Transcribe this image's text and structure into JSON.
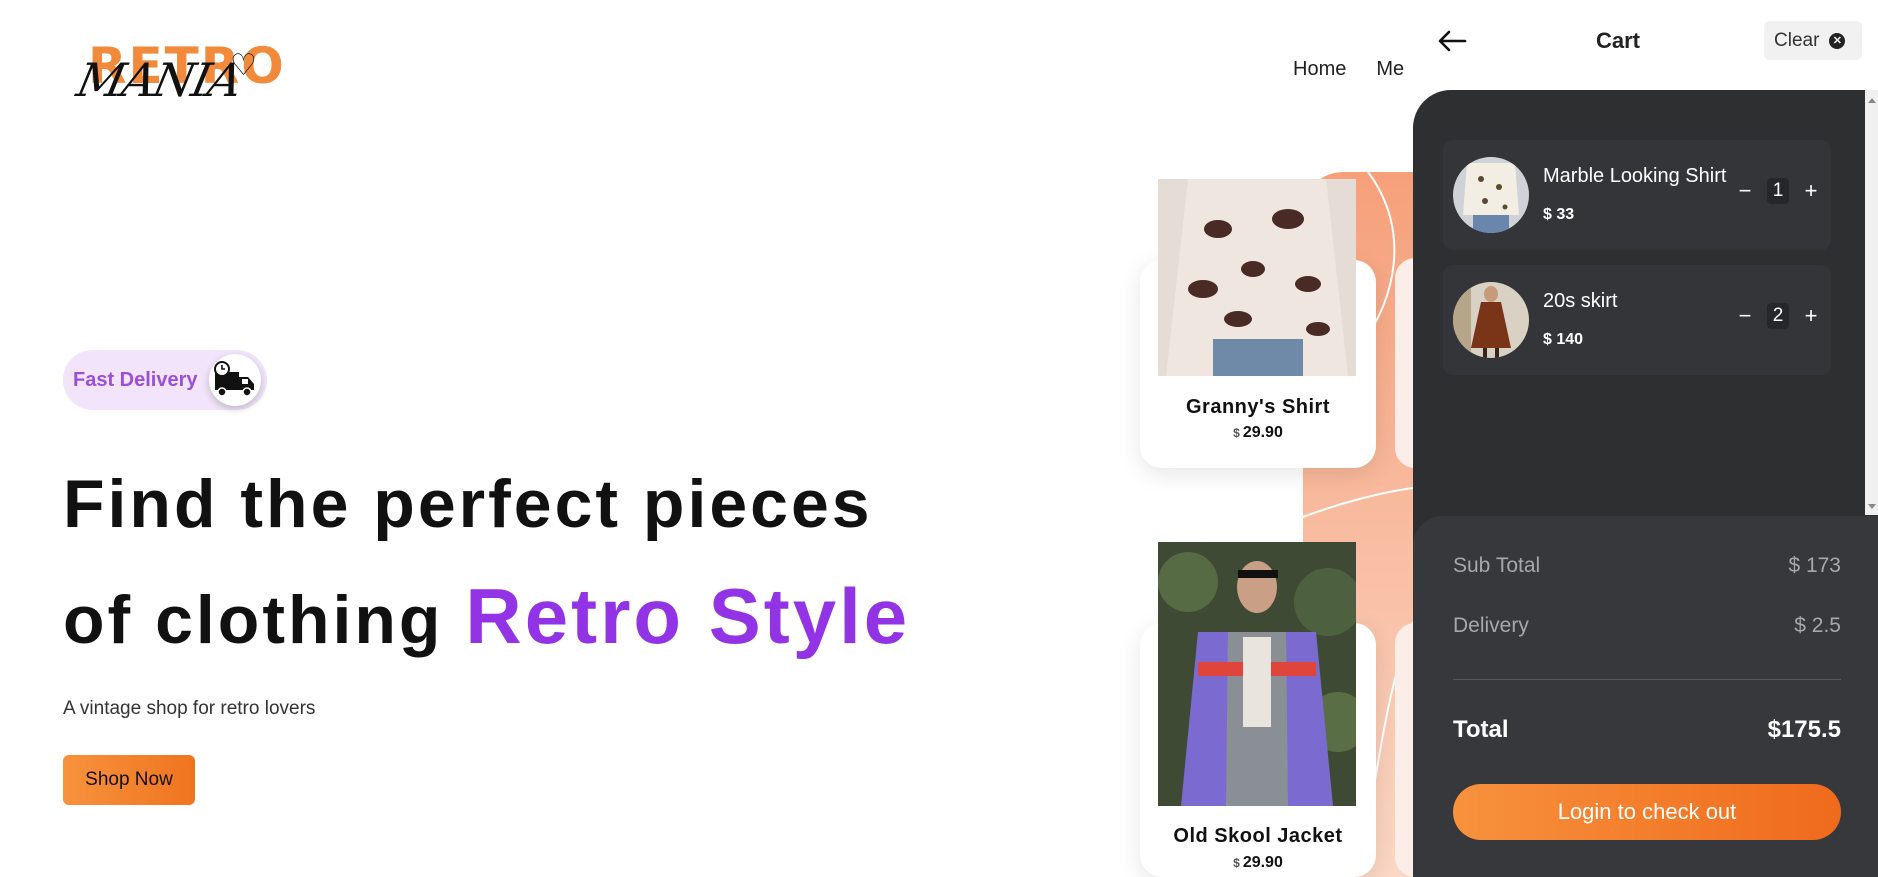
{
  "brand": {
    "logo_word": "RETRO",
    "logo_script": "MANIA"
  },
  "nav": {
    "home": "Home",
    "partial": "Me"
  },
  "hero": {
    "badge": "Fast Delivery",
    "headline_line1": "Find the perfect pieces",
    "headline_line2": "of clothing",
    "headline_accent": "Retro Style",
    "subtitle": "A vintage shop for retro lovers",
    "cta": "Shop Now"
  },
  "products": [
    {
      "name": "Granny's Shirt",
      "currency": "$",
      "price": "29.90"
    },
    {
      "name": "Old Skool Jacket",
      "currency": "$",
      "price": "29.90"
    }
  ],
  "cart": {
    "title": "Cart",
    "clear_label": "Clear",
    "items": [
      {
        "name": "Marble Looking Shirt",
        "price": "$ 33",
        "qty": "1"
      },
      {
        "name": "20s skirt",
        "price": "$ 140",
        "qty": "2"
      }
    ],
    "summary": {
      "subtotal_label": "Sub Total",
      "subtotal_value": "$ 173",
      "delivery_label": "Delivery",
      "delivery_value": "$ 2.5",
      "total_label": "Total",
      "total_value": "$175.5"
    },
    "checkout_label": "Login to check out"
  },
  "colors": {
    "accent_purple": "#9234e6",
    "accent_orange": "#f28a3c",
    "cart_bg": "#2e2f31"
  }
}
